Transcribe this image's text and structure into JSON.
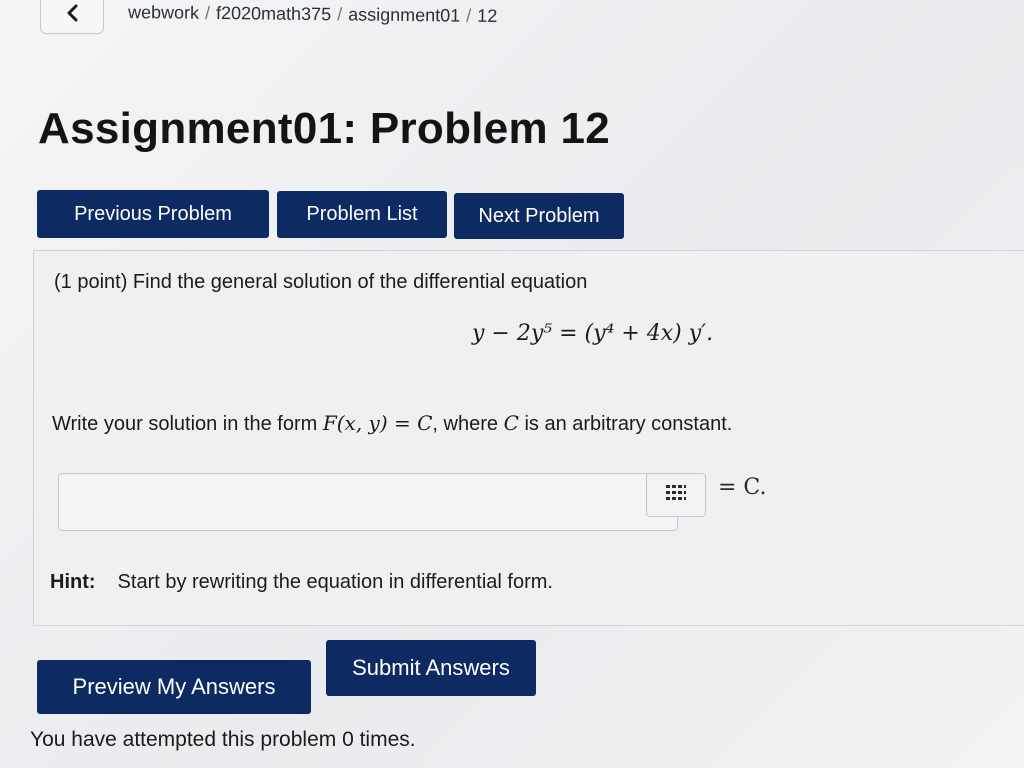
{
  "breadcrumb": [
    "webwork",
    "f2020math375",
    "assignment01",
    "12"
  ],
  "page_title": "Assignment01: Problem 12",
  "nav": {
    "previous": "Previous Problem",
    "list": "Problem List",
    "next": "Next Problem"
  },
  "problem": {
    "prompt": "(1 point) Find the general solution of the differential equation",
    "equation": "y − 2y⁵ = (y⁴ + 4x) y′.",
    "instruction_before": "Write your solution in the form ",
    "instruction_form": "F(x, y) = C",
    "instruction_after": ", where ",
    "instruction_var": "C",
    "instruction_end": " is an arbitrary constant.",
    "answer_value": "",
    "equals_c": "= C.",
    "hint_label": "Hint:",
    "hint_text": "Start by rewriting the equation in differential form."
  },
  "actions": {
    "preview": "Preview My Answers",
    "submit": "Submit Answers"
  },
  "attempts_text": "You have attempted this problem 0 times.",
  "icons": {
    "back": "chevron-left-icon",
    "toolbar": "grid-icon"
  },
  "colors": {
    "button_bg": "#0e2a63",
    "button_text": "#ffffff"
  }
}
